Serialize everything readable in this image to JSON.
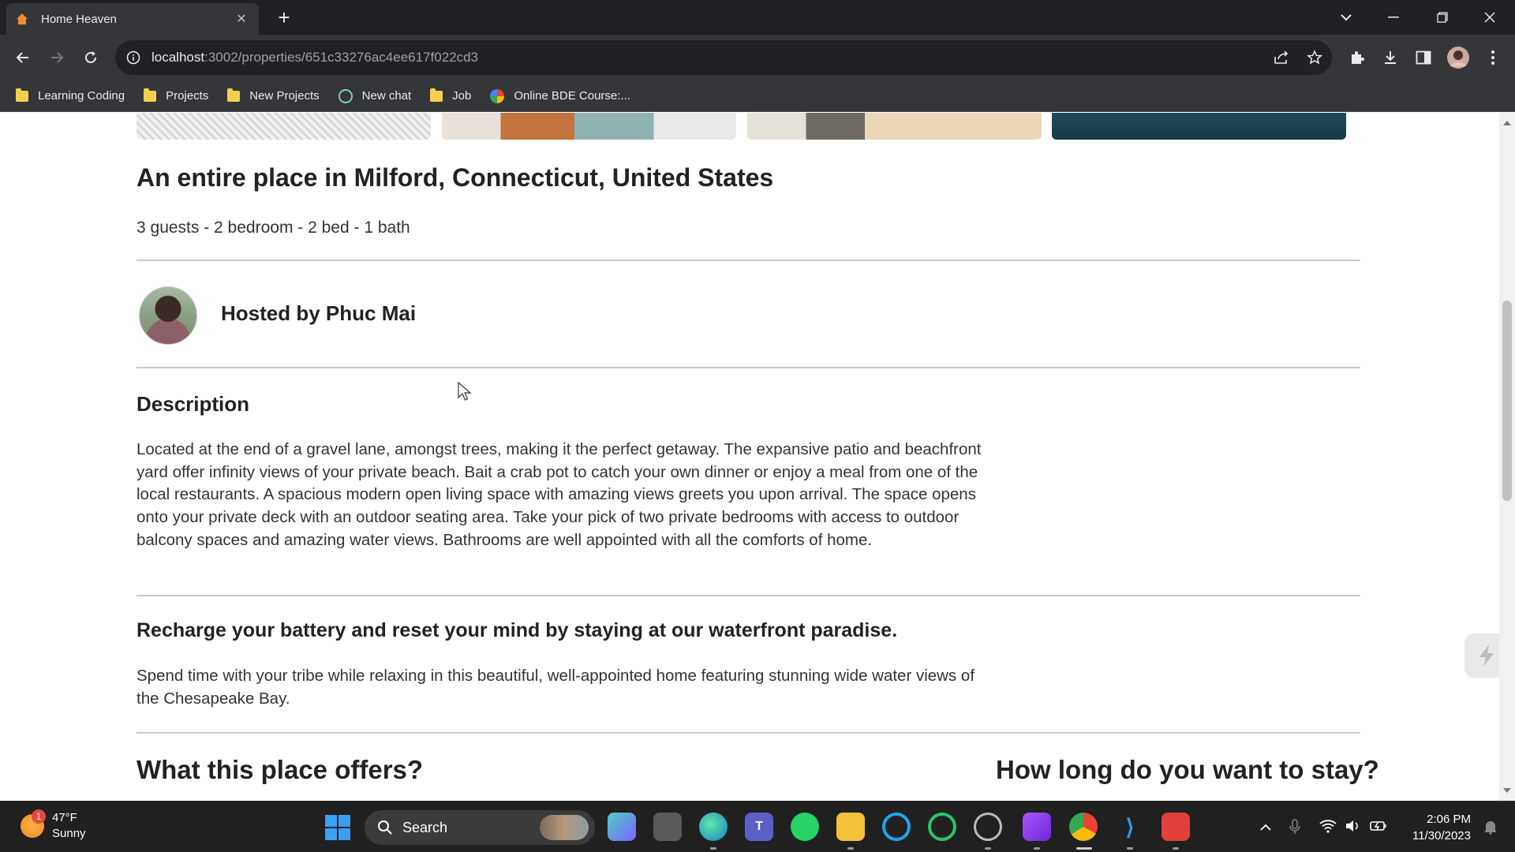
{
  "browser": {
    "tab_title": "Home Heaven",
    "url_host": "localhost",
    "url_path": ":3002/properties/651c33276ac4ee617f022cd3",
    "new_tab_symbol": "+",
    "tab_close_symbol": "✕"
  },
  "bookmarks": [
    {
      "label": "Learning Coding",
      "icon": "folder-icon"
    },
    {
      "label": "Projects",
      "icon": "folder-icon"
    },
    {
      "label": "New Projects",
      "icon": "folder-icon"
    },
    {
      "label": "New chat",
      "icon": "chatgpt-icon"
    },
    {
      "label": "Job",
      "icon": "folder-icon"
    },
    {
      "label": "Online BDE Course:...",
      "icon": "google-icon"
    }
  ],
  "listing": {
    "title": "An entire place in Milford, Connecticut, United States",
    "stats": "3 guests - 2 bedroom - 2 bed - 1 bath",
    "host": "Hosted by Phuc Mai",
    "description_heading": "Description",
    "description": "Located at the end of a gravel lane, amongst trees, making it the perfect getaway. The expansive patio and beachfront yard offer infinity views of your private beach. Bait a crab pot to catch your own dinner or enjoy a meal from one of the local restaurants. A spacious modern open living space with amazing views greets you upon arrival. The space opens onto your private deck with an outdoor seating area. Take your pick of two private bedrooms with access to outdoor balcony spaces and amazing water views. Bathrooms are well appointed with all the comforts of home.",
    "highlight_heading": "Recharge your battery and reset your mind by staying at our waterfront paradise.",
    "highlight_text": "Spend time with your tribe while relaxing in this beautiful, well-appointed home featuring stunning wide water views of the Chesapeake Bay.",
    "offers_heading": "What this place offers?",
    "stay_heading": "How long do you want to stay?"
  },
  "taskbar": {
    "weather_temp": "47°F",
    "weather_desc": "Sunny",
    "weather_badge": "1",
    "search_label": "Search",
    "time": "2:06 PM",
    "date": "11/30/2023"
  },
  "colors": {
    "chrome_dark": "#202124",
    "chrome_toolbar": "#35363a",
    "taskbar": "#202020",
    "folder": "#f6d04d"
  }
}
